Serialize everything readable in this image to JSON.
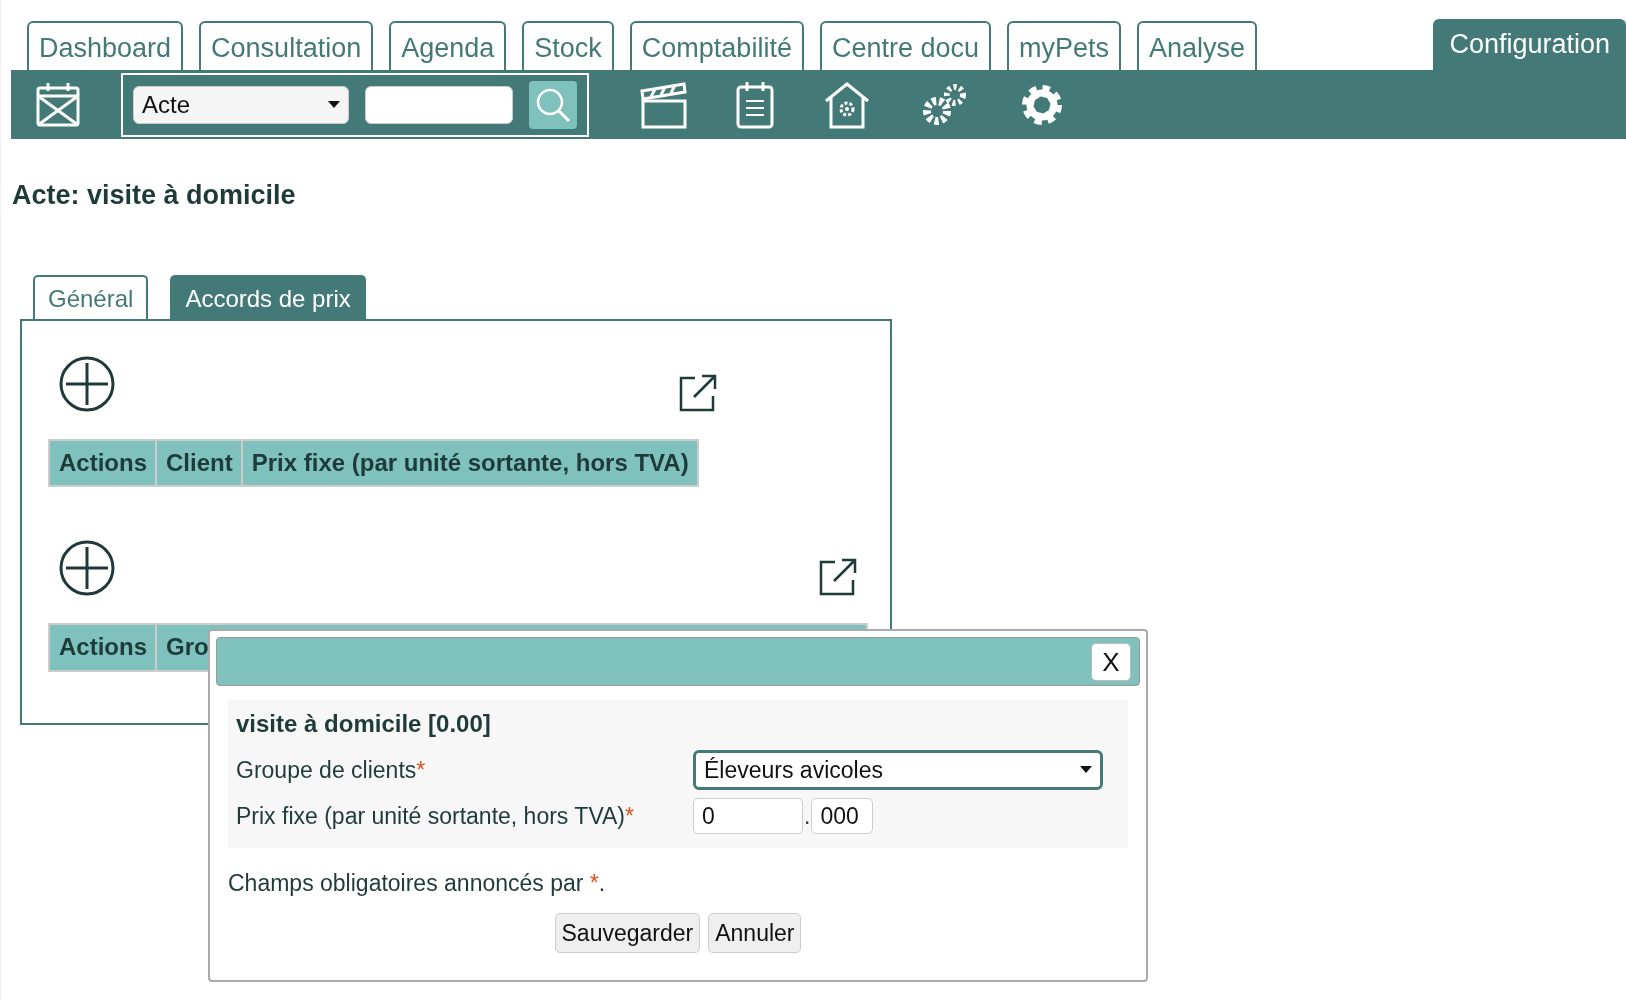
{
  "top_tabs": [
    {
      "label": "Dashboard",
      "selected": false
    },
    {
      "label": "Consultation",
      "selected": false
    },
    {
      "label": "Agenda",
      "selected": false
    },
    {
      "label": "Stock",
      "selected": false
    },
    {
      "label": "Comptabilité",
      "selected": false
    },
    {
      "label": "Centre docu",
      "selected": false
    },
    {
      "label": "myPets",
      "selected": false
    },
    {
      "label": "Analyse",
      "selected": false
    },
    {
      "label": "Configuration",
      "selected": true
    }
  ],
  "toolbar": {
    "search_type": "Acte"
  },
  "title": "Acte: visite à domicile",
  "tabs": [
    {
      "label": "Général",
      "selected": false
    },
    {
      "label": "Accords de prix",
      "selected": true
    }
  ],
  "tables": [
    {
      "columns": [
        "Actions",
        "Client",
        "Prix fixe (par unité sortante, hors TVA)"
      ]
    },
    {
      "columns": [
        "Actions",
        "Gro"
      ]
    }
  ],
  "dialog": {
    "close": "X",
    "heading": "visite à domicile [0.00]",
    "fields": [
      {
        "kind": "select",
        "label": "Groupe de clients",
        "required_mark": "*",
        "value": "Éleveurs avicoles"
      },
      {
        "kind": "decimal",
        "label": "Prix fixe (par unité sortante, hors TVA)",
        "required_mark": "*",
        "integer": "0",
        "separator": ".",
        "decimals": "000"
      }
    ],
    "note": {
      "text": "Champs obligatoires annoncés par ",
      "mark": "*",
      "end": "."
    },
    "buttons": [
      "Sauvegarder",
      "Annuler"
    ]
  }
}
